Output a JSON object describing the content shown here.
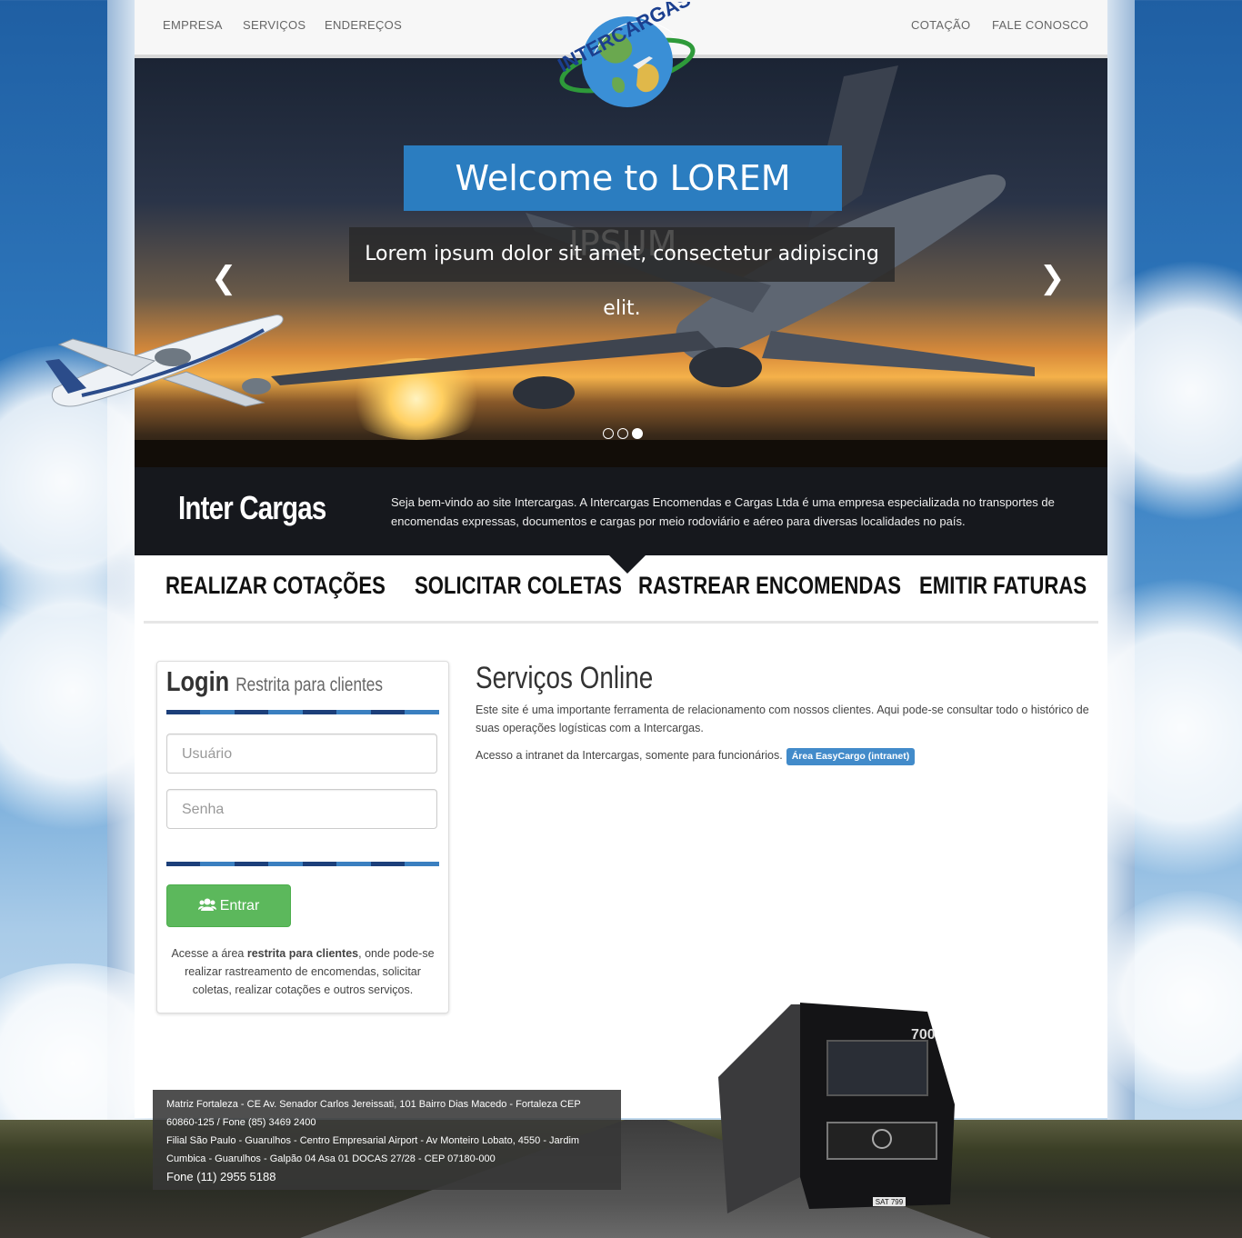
{
  "nav": {
    "left": [
      "EMPRESA",
      "SERVIÇOS",
      "ENDEREÇOS"
    ],
    "right": [
      "COTAÇÃO",
      "FALE CONOSCO"
    ]
  },
  "logo": {
    "text": "INTERCARGAS",
    "colors": [
      "#1b3f8f",
      "#d1232a",
      "#2e9a3a",
      "#3a8fd6"
    ]
  },
  "hero": {
    "title": "Welcome to LOREM IPSUM",
    "subtitle": "Lorem ipsum dolor sit amet, consectetur adipiscing elit.",
    "prev_icon": "chevron-left-icon",
    "next_icon": "chevron-right-icon",
    "slides_count": 3,
    "active_slide": 3
  },
  "intro": {
    "brand": "Inter Cargas",
    "text": "Seja bem-vindo ao site Intercargas. A Intercargas Encomendas e Cargas Ltda é uma empresa especializada no transportes de encomendas expressas, documentos e cargas por meio rodoviário e aéreo para diversas localidades no país."
  },
  "actions": [
    "REALIZAR COTAÇÕES",
    "SOLICITAR COLETAS",
    "RASTREAR ENCOMENDAS",
    "EMITIR FATURAS"
  ],
  "login": {
    "title": "Login",
    "subtitle": "Restrita para clientes",
    "user_placeholder": "Usuário",
    "pass_placeholder": "Senha",
    "button": "Entrar",
    "button_icon": "users-icon",
    "note_prefix": "Acesse a área ",
    "note_bold": "restrita para clientes",
    "note_suffix": ", onde pode-se realizar rastreamento de encomendas, solicitar coletas, realizar cotações e outros serviços."
  },
  "services": {
    "title": "Serviços Online",
    "p1": "Este site é uma importante ferramenta de relacionamento com nossos clientes. Aqui pode-se consultar todo o histórico de suas operações logísticas com a Intercargas.",
    "p2": "Acesso a intranet da Intercargas, somente para funcionários.",
    "intranet_label": "Área EasyCargo (intranet)"
  },
  "footer": {
    "matriz": "Matriz Fortaleza - CE Av. Senador Carlos Jereissati, 101 Bairro Dias Macedo - Fortaleza CEP 60860-125 / Fone (85) 3469 2400",
    "filial": "Filial São Paulo - Guarulhos - Centro Empresarial Airport - Av Monteiro Lobato, 4550 - Jardim Cumbica - Guarulhos - Galpão 04 Asa 01 DOCAS 27/28 - CEP 07180-000",
    "fone": "Fone (11) 2955 5188"
  },
  "truck": {
    "plate": "SAT 799",
    "badge": "700"
  }
}
